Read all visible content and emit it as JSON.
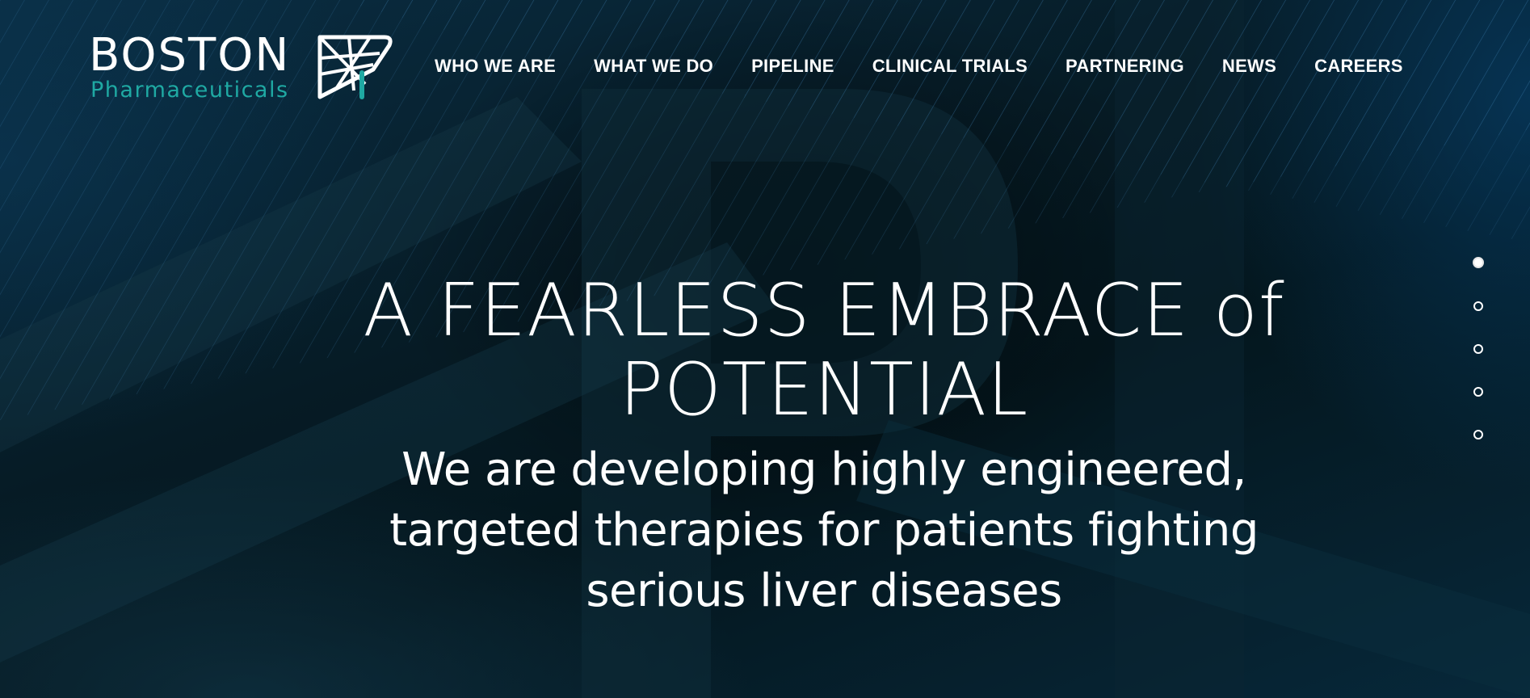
{
  "brand": {
    "name": "BOSTON",
    "subname": "Pharmaceuticals",
    "accent_color": "#1fa9a3",
    "mark_icon": "boston-pharma-logo-mark"
  },
  "nav": {
    "items": [
      {
        "label": "WHO WE ARE"
      },
      {
        "label": "WHAT WE DO"
      },
      {
        "label": "PIPELINE"
      },
      {
        "label": "CLINICAL TRIALS"
      },
      {
        "label": "PARTNERING"
      },
      {
        "label": "NEWS"
      },
      {
        "label": "CAREERS"
      }
    ]
  },
  "hero": {
    "title_line1_main": "A FEARLESS EMBRACE ",
    "title_line1_small": "of",
    "title_line2": "POTENTIAL",
    "subtitle_line1": "We are developing highly engineered,",
    "subtitle_line2": "targeted therapies for patients fighting",
    "subtitle_line3": "serious liver diseases"
  },
  "slider": {
    "total_slides": 5,
    "active_slide": 1
  },
  "colors": {
    "background": "#051c26",
    "text": "#ffffff"
  }
}
